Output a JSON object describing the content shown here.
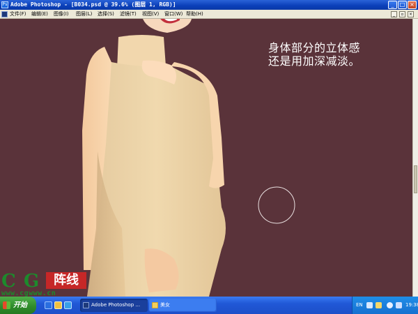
{
  "window": {
    "title": "Adobe Photoshop - [B034.psd @ 39.6% (图层 1, RGB)]",
    "app_icon": "photoshop-icon",
    "controls": {
      "minimize": "_",
      "maximize": "□",
      "close": "×"
    }
  },
  "menubar": {
    "items": [
      {
        "label": "文件(F)"
      },
      {
        "label": "编辑(E)"
      },
      {
        "label": "图像(I)"
      },
      {
        "label": "图层(L)"
      },
      {
        "label": "选择(S)"
      },
      {
        "label": "滤镜(T)"
      },
      {
        "label": "视图(V)"
      },
      {
        "label": "窗口(W)"
      },
      {
        "label": "帮助(H)"
      }
    ],
    "doc_controls": {
      "minimize": "_",
      "restore": "▫",
      "close": "×"
    }
  },
  "canvas": {
    "background_color": "#5a333a",
    "annotation_line1": "身体部分的立体感",
    "annotation_line2": "还是用加深减淡。",
    "brush_cursor": "brush-circle"
  },
  "watermark": {
    "letter_c": "C",
    "letter_g": "G",
    "seal_text": "阵线",
    "url": "www.cgwww.cn"
  },
  "taskbar": {
    "start_label": "开始",
    "tasks": [
      {
        "label": "Adobe Photoshop ...",
        "icon": "photoshop-icon",
        "active": true
      },
      {
        "label": "美女",
        "icon": "folder-icon",
        "active": false
      }
    ],
    "tray": {
      "language": "EN",
      "clock": "19:38"
    }
  }
}
